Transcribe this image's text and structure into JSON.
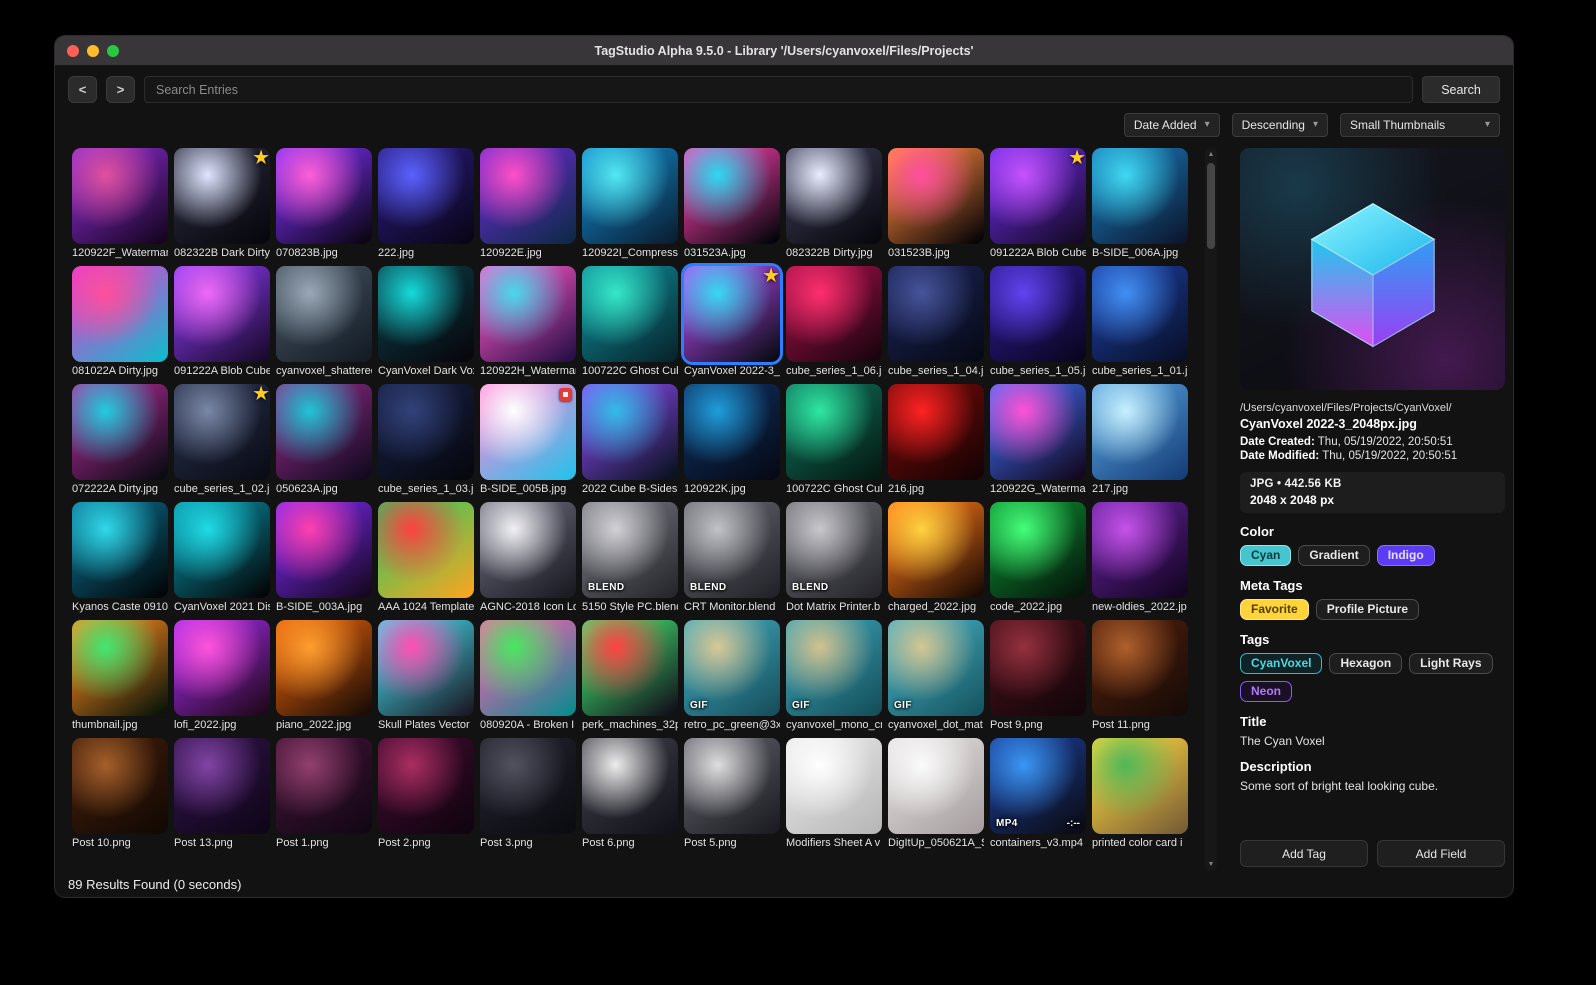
{
  "window": {
    "title": "TagStudio Alpha 9.5.0 - Library '/Users/cyanvoxel/Files/Projects'"
  },
  "icons": {
    "chevron_down": "▾",
    "star": "★",
    "scroll_up": "▲",
    "scroll_down": "▼"
  },
  "toolbar": {
    "back": "<",
    "forward": ">",
    "search_placeholder": "Search Entries",
    "search_button": "Search"
  },
  "sort": {
    "field": "Date Added",
    "direction": "Descending",
    "thumb_size": "Small Thumbnails"
  },
  "status": "89 Results Found (0 seconds)",
  "grid": {
    "items": [
      {
        "name": "120922F_Watermark",
        "g": [
          "#e0519e",
          "#8a2bd0",
          "#160522"
        ]
      },
      {
        "name": "082322B Dark Dirty",
        "g": [
          "#dfe6ff",
          "#2a2a3e",
          "#07070d"
        ],
        "badge": "star"
      },
      {
        "name": "070823B.jpg",
        "g": [
          "#ff5fd6",
          "#7b2ff7",
          "#0c0616"
        ]
      },
      {
        "name": "222.jpg",
        "g": [
          "#5a62ff",
          "#2a1a7a",
          "#0a0618"
        ]
      },
      {
        "name": "120922E.jpg",
        "g": [
          "#ff4fc8",
          "#6a2ad0",
          "#0e2a4a"
        ]
      },
      {
        "name": "120922I_Compressed",
        "g": [
          "#52e8f2",
          "#1286c8",
          "#0a2034"
        ]
      },
      {
        "name": "031523A.jpg",
        "g": [
          "#2bd9f2",
          "#ff3fae",
          "#05060c"
        ]
      },
      {
        "name": "082322B Dirty.jpg",
        "g": [
          "#e9edff",
          "#3a3a54",
          "#08080e"
        ]
      },
      {
        "name": "031523B.jpg",
        "g": [
          "#ff4f9e",
          "#ff8a3c",
          "#0a0508"
        ]
      },
      {
        "name": "091222A Blob Cube",
        "g": [
          "#c553ff",
          "#6a2ae0",
          "#150a26"
        ],
        "badge": "star"
      },
      {
        "name": "B-SIDE_006A.jpg",
        "g": [
          "#3fd9f2",
          "#1878b8",
          "#0c1830"
        ]
      },
      {
        "name": "081022A Dirty.jpg",
        "g": [
          "#ff4f9a",
          "#e23fd0",
          "#14b8cc"
        ]
      },
      {
        "name": "091222A Blob Cube",
        "g": [
          "#ee6af5",
          "#8a3af0",
          "#1a0a2e"
        ]
      },
      {
        "name": "cyanvoxel_shattered",
        "g": [
          "#9aa8b8",
          "#44525f",
          "#141c26"
        ]
      },
      {
        "name": "CyanVoxel Dark Vox",
        "g": [
          "#16dada",
          "#0b3c46",
          "#07070d"
        ]
      },
      {
        "name": "120922H_Watermark",
        "g": [
          "#47d9ec",
          "#ff57c8",
          "#2a1048"
        ]
      },
      {
        "name": "100722C Ghost Cub",
        "g": [
          "#35e8c8",
          "#0e8a98",
          "#07262e"
        ]
      },
      {
        "name": "CyanVoxel 2022-3_",
        "g": [
          "#37d9f2",
          "#b44af0",
          "#0c0c18"
        ],
        "badge": "star",
        "sel": true
      },
      {
        "name": "cube_series_1_06.j",
        "g": [
          "#ff2f6e",
          "#a01048",
          "#1a040e"
        ]
      },
      {
        "name": "cube_series_1_04.j",
        "g": [
          "#46549a",
          "#1a2254",
          "#070a16"
        ]
      },
      {
        "name": "cube_series_1_05.j",
        "g": [
          "#6243f0",
          "#2c1a8e",
          "#0a0620"
        ]
      },
      {
        "name": "cube_series_1_01.j",
        "g": [
          "#4290f5",
          "#1c3c9e",
          "#081028"
        ]
      },
      {
        "name": "072222A Dirty.jpg",
        "g": [
          "#22ccdf",
          "#b02a96",
          "#0b0b14"
        ]
      },
      {
        "name": "cube_series_1_02.j",
        "g": [
          "#7a88a6",
          "#262e4a",
          "#0a0c16"
        ],
        "badge": "star"
      },
      {
        "name": "050623A.jpg",
        "g": [
          "#1fc4d6",
          "#8e2a86",
          "#120a20"
        ]
      },
      {
        "name": "cube_series_1_03.j",
        "g": [
          "#32427a",
          "#161e40",
          "#06080f"
        ]
      },
      {
        "name": "B-SIDE_005B.jpg",
        "g": [
          "#ffffff",
          "#ff8ad8",
          "#2ac0ea"
        ],
        "badge": "red"
      },
      {
        "name": "2022 Cube B-Sides",
        "g": [
          "#33bce8",
          "#8a4af0",
          "#0b1222"
        ]
      },
      {
        "name": "120922K.jpg",
        "g": [
          "#1f9edc",
          "#0e2e5e",
          "#060a16"
        ]
      },
      {
        "name": "100722C Ghost Cub",
        "g": [
          "#2fe8a2",
          "#0e6e5a",
          "#051a12"
        ]
      },
      {
        "name": "216.jpg",
        "g": [
          "#ff2222",
          "#740a0a",
          "#170303"
        ]
      },
      {
        "name": "120922G_Watermar",
        "g": [
          "#ff52d6",
          "#3e6cf0",
          "#130820"
        ]
      },
      {
        "name": "217.jpg",
        "g": [
          "#c8f1ff",
          "#54a0dc",
          "#173f78"
        ]
      },
      {
        "name": "Kyanos Caste 0910",
        "g": [
          "#2fd9ea",
          "#0b6e8e",
          "#020608"
        ]
      },
      {
        "name": "CyanVoxel 2021 Dis",
        "g": [
          "#1fdce6",
          "#0a8ca2",
          "#030708"
        ]
      },
      {
        "name": "B-SIDE_003A.jpg",
        "g": [
          "#ff3fae",
          "#7a2af0",
          "#170722"
        ]
      },
      {
        "name": "AAA 1024 Template",
        "g": [
          "#ff4040",
          "#2fc85e",
          "#f5a623"
        ]
      },
      {
        "name": "AGNC-2018 Icon Lo",
        "g": [
          "#f2f2f5",
          "#6a6a7c",
          "#1b1b23"
        ]
      },
      {
        "name": "5150 Style PC.blend",
        "g": [
          "#d2d2d6",
          "#74747e",
          "#27272d"
        ],
        "badge": "BLEND"
      },
      {
        "name": "CRT Monitor.blend",
        "g": [
          "#c2c2c8",
          "#65656e",
          "#23232a"
        ],
        "badge": "BLEND"
      },
      {
        "name": "Dot Matrix Printer.b",
        "g": [
          "#c8c8cc",
          "#6c6c74",
          "#25252b"
        ],
        "badge": "BLEND"
      },
      {
        "name": "charged_2022.jpg",
        "g": [
          "#ffd23f",
          "#ff7a1a",
          "#1c0b04"
        ]
      },
      {
        "name": "code_2022.jpg",
        "g": [
          "#45ff7a",
          "#0c8c30",
          "#05150b"
        ]
      },
      {
        "name": "new-oldies_2022.jp",
        "g": [
          "#c653ea",
          "#61209a",
          "#140522"
        ]
      },
      {
        "name": "thumbnail.jpg",
        "g": [
          "#40e872",
          "#ff8a1f",
          "#0b1509"
        ]
      },
      {
        "name": "lofi_2022.jpg",
        "g": [
          "#ff54dc",
          "#a22ae6",
          "#20081c"
        ]
      },
      {
        "name": "piano_2022.jpg",
        "g": [
          "#ff9e2e",
          "#e2600c",
          "#1c0d05"
        ]
      },
      {
        "name": "Skull Plates Vector",
        "g": [
          "#ff4fb2",
          "#42d9ea",
          "#1c1c28"
        ]
      },
      {
        "name": "080920A - Broken I",
        "g": [
          "#45e85f",
          "#ff5fb2",
          "#0e8a8e"
        ]
      },
      {
        "name": "perk_machines_32p",
        "g": [
          "#ff4242",
          "#42e872",
          "#12121c"
        ]
      },
      {
        "name": "retro_pc_green@3x",
        "g": [
          "#d8c896",
          "#3fa8bc",
          "#17505e"
        ],
        "badge": "GIF"
      },
      {
        "name": "cyanvoxel_mono_cr",
        "g": [
          "#d2c28e",
          "#3ba2b6",
          "#15505c"
        ],
        "badge": "GIF"
      },
      {
        "name": "cyanvoxel_dot_mat",
        "g": [
          "#d5c692",
          "#45aec2",
          "#175662"
        ],
        "badge": "GIF"
      },
      {
        "name": "Post 9.png",
        "g": [
          "#95303f",
          "#421018",
          "#13060a"
        ]
      },
      {
        "name": "Post 11.png",
        "g": [
          "#b0602c",
          "#4e1e0c",
          "#170b06"
        ]
      },
      {
        "name": "Post 10.png",
        "g": [
          "#a5602a",
          "#3f1c09",
          "#130904"
        ]
      },
      {
        "name": "Post 13.png",
        "g": [
          "#8244a6",
          "#2e1246",
          "#0f0619"
        ]
      },
      {
        "name": "Post 1.png",
        "g": [
          "#92406e",
          "#3e1234",
          "#130715"
        ]
      },
      {
        "name": "Post 2.png",
        "g": [
          "#aa2e60",
          "#3c0a2e",
          "#11040f"
        ]
      },
      {
        "name": "Post 3.png",
        "g": [
          "#52525f",
          "#22222e",
          "#0b0b11"
        ]
      },
      {
        "name": "Post 6.png",
        "g": [
          "#ededed",
          "#3e3e48",
          "#12121a"
        ]
      },
      {
        "name": "Post 5.png",
        "g": [
          "#dedede",
          "#60606a",
          "#1c1c22"
        ]
      },
      {
        "name": "Modifiers Sheet A v",
        "g": [
          "#ffffff",
          "#e8e8e8",
          "#b8b8b8"
        ]
      },
      {
        "name": "DigItUp_050621A_S",
        "g": [
          "#fbfbfb",
          "#e2dede",
          "#a8a0a0"
        ]
      },
      {
        "name": "containers_v3.mp4",
        "g": [
          "#3a96f5",
          "#1a3e96",
          "#0b0b14"
        ],
        "badge": "MP4",
        "dur": "-:--"
      },
      {
        "name": "printed color card i",
        "g": [
          "#4fb858",
          "#ffd83f",
          "#7a5f36"
        ]
      }
    ]
  },
  "preview": {
    "path": "/Users/cyanvoxel/Files/Projects/CyanVoxel/",
    "filename": "CyanVoxel 2022-3_2048px.jpg",
    "date_created_label": "Date Created:",
    "date_created": "Thu, 05/19/2022, 20:50:51",
    "date_modified_label": "Date Modified:",
    "date_modified": "Thu, 05/19/2022, 20:50:51",
    "file_type": "JPG",
    "bullet": "•",
    "file_size": "442.56 KB",
    "dimensions": "2048 x 2048 px"
  },
  "sections": {
    "color": {
      "label": "Color",
      "tags": [
        {
          "label": "Cyan",
          "bg": "#46c5ce",
          "fg": "#063a3f",
          "border": "#8fe8ee"
        },
        {
          "label": "Gradient",
          "bg": "#1e1e1e",
          "fg": "#e8e8e8",
          "border": "#4a4a4a"
        },
        {
          "label": "Indigo",
          "bg": "#5c3bf5",
          "fg": "#e6ddff",
          "border": "#8d6ff8"
        }
      ]
    },
    "meta": {
      "label": "Meta Tags",
      "tags": [
        {
          "label": "Favorite",
          "bg": "#ffd43b",
          "fg": "#503e00",
          "border": "#ffe58a"
        },
        {
          "label": "Profile Picture",
          "bg": "#1e1e1e",
          "fg": "#e8e8e8",
          "border": "#4a4a4a"
        }
      ]
    },
    "tags": {
      "label": "Tags",
      "tags": [
        {
          "label": "CyanVoxel",
          "bg": "#0f2326",
          "fg": "#4fd8e0",
          "border": "#3ab8c4"
        },
        {
          "label": "Hexagon",
          "bg": "#1e1e1e",
          "fg": "#e8e8e8",
          "border": "#4a4a4a"
        },
        {
          "label": "Light Rays",
          "bg": "#1e1e1e",
          "fg": "#e8e8e8",
          "border": "#4a4a4a"
        },
        {
          "label": "Neon",
          "bg": "#1a1026",
          "fg": "#b07af5",
          "border": "#8a5cf0"
        }
      ]
    },
    "title": {
      "label": "Title",
      "value": "The Cyan Voxel"
    },
    "description": {
      "label": "Description",
      "value": "Some sort of bright teal looking cube."
    }
  },
  "panel_buttons": {
    "add_tag": "Add Tag",
    "add_field": "Add Field"
  }
}
